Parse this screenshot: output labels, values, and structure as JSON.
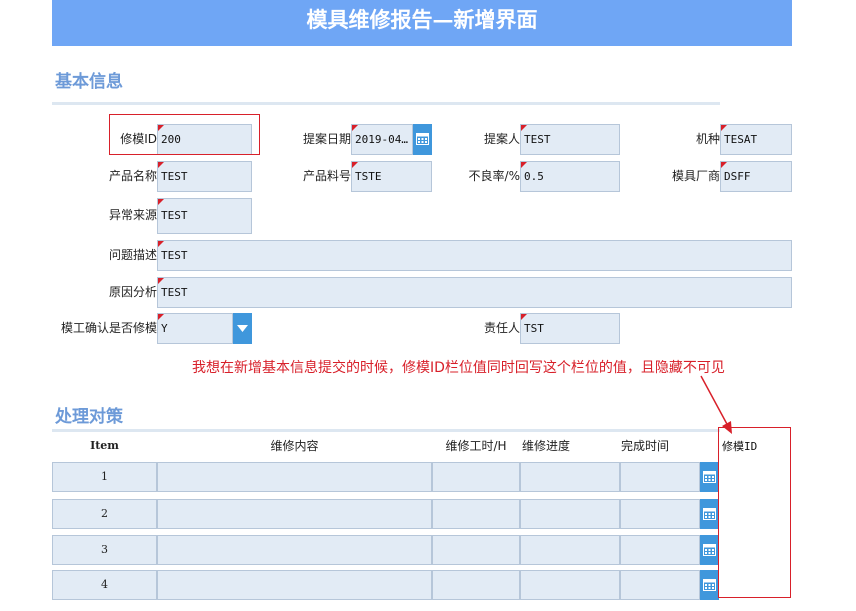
{
  "page_title": "模具维修报告—新增界面",
  "basic_info": {
    "section_title": "基本信息",
    "fields": {
      "mold_id": {
        "label": "修模ID",
        "value": "200"
      },
      "proposal_date": {
        "label": "提案日期",
        "value": "2019-04…"
      },
      "proposer": {
        "label": "提案人",
        "value": "TEST"
      },
      "model_type": {
        "label": "机种",
        "value": "TESAT"
      },
      "product_name": {
        "label": "产品名称",
        "value": "TEST"
      },
      "product_part_no": {
        "label": "产品料号",
        "value": "TSTE"
      },
      "defect_rate": {
        "label": "不良率/%",
        "value": "0.5"
      },
      "mold_vendor": {
        "label": "模具厂商",
        "value": "DSFF"
      },
      "abnormal_source": {
        "label": "异常来源",
        "value": "TEST"
      },
      "problem_desc": {
        "label": "问题描述",
        "value": "TEST"
      },
      "cause_analysis": {
        "label": "原因分析",
        "value": "TEST"
      },
      "repair_confirm": {
        "label": "模工确认是否修模",
        "value": "Y"
      },
      "responsible": {
        "label": "责任人",
        "value": "TST"
      }
    }
  },
  "annotation_note": "我想在新增基本信息提交的时候，修模ID栏位值同时回写这个栏位的值，且隐藏不可见",
  "countermeasures": {
    "section_title": "处理对策",
    "headers": [
      "Item",
      "维修内容",
      "维修工时/H",
      "维修进度",
      "完成时间"
    ],
    "rows": [
      {
        "item": "1"
      },
      {
        "item": "2"
      },
      {
        "item": "3"
      },
      {
        "item": "4"
      }
    ],
    "side_column_label": "修模ID"
  },
  "colors": {
    "banner": "#6fa6f5",
    "section_title": "#6d9ad8",
    "field_bg": "#e2ebf5",
    "button": "#3f97dc",
    "annotation": "#d8202a"
  }
}
